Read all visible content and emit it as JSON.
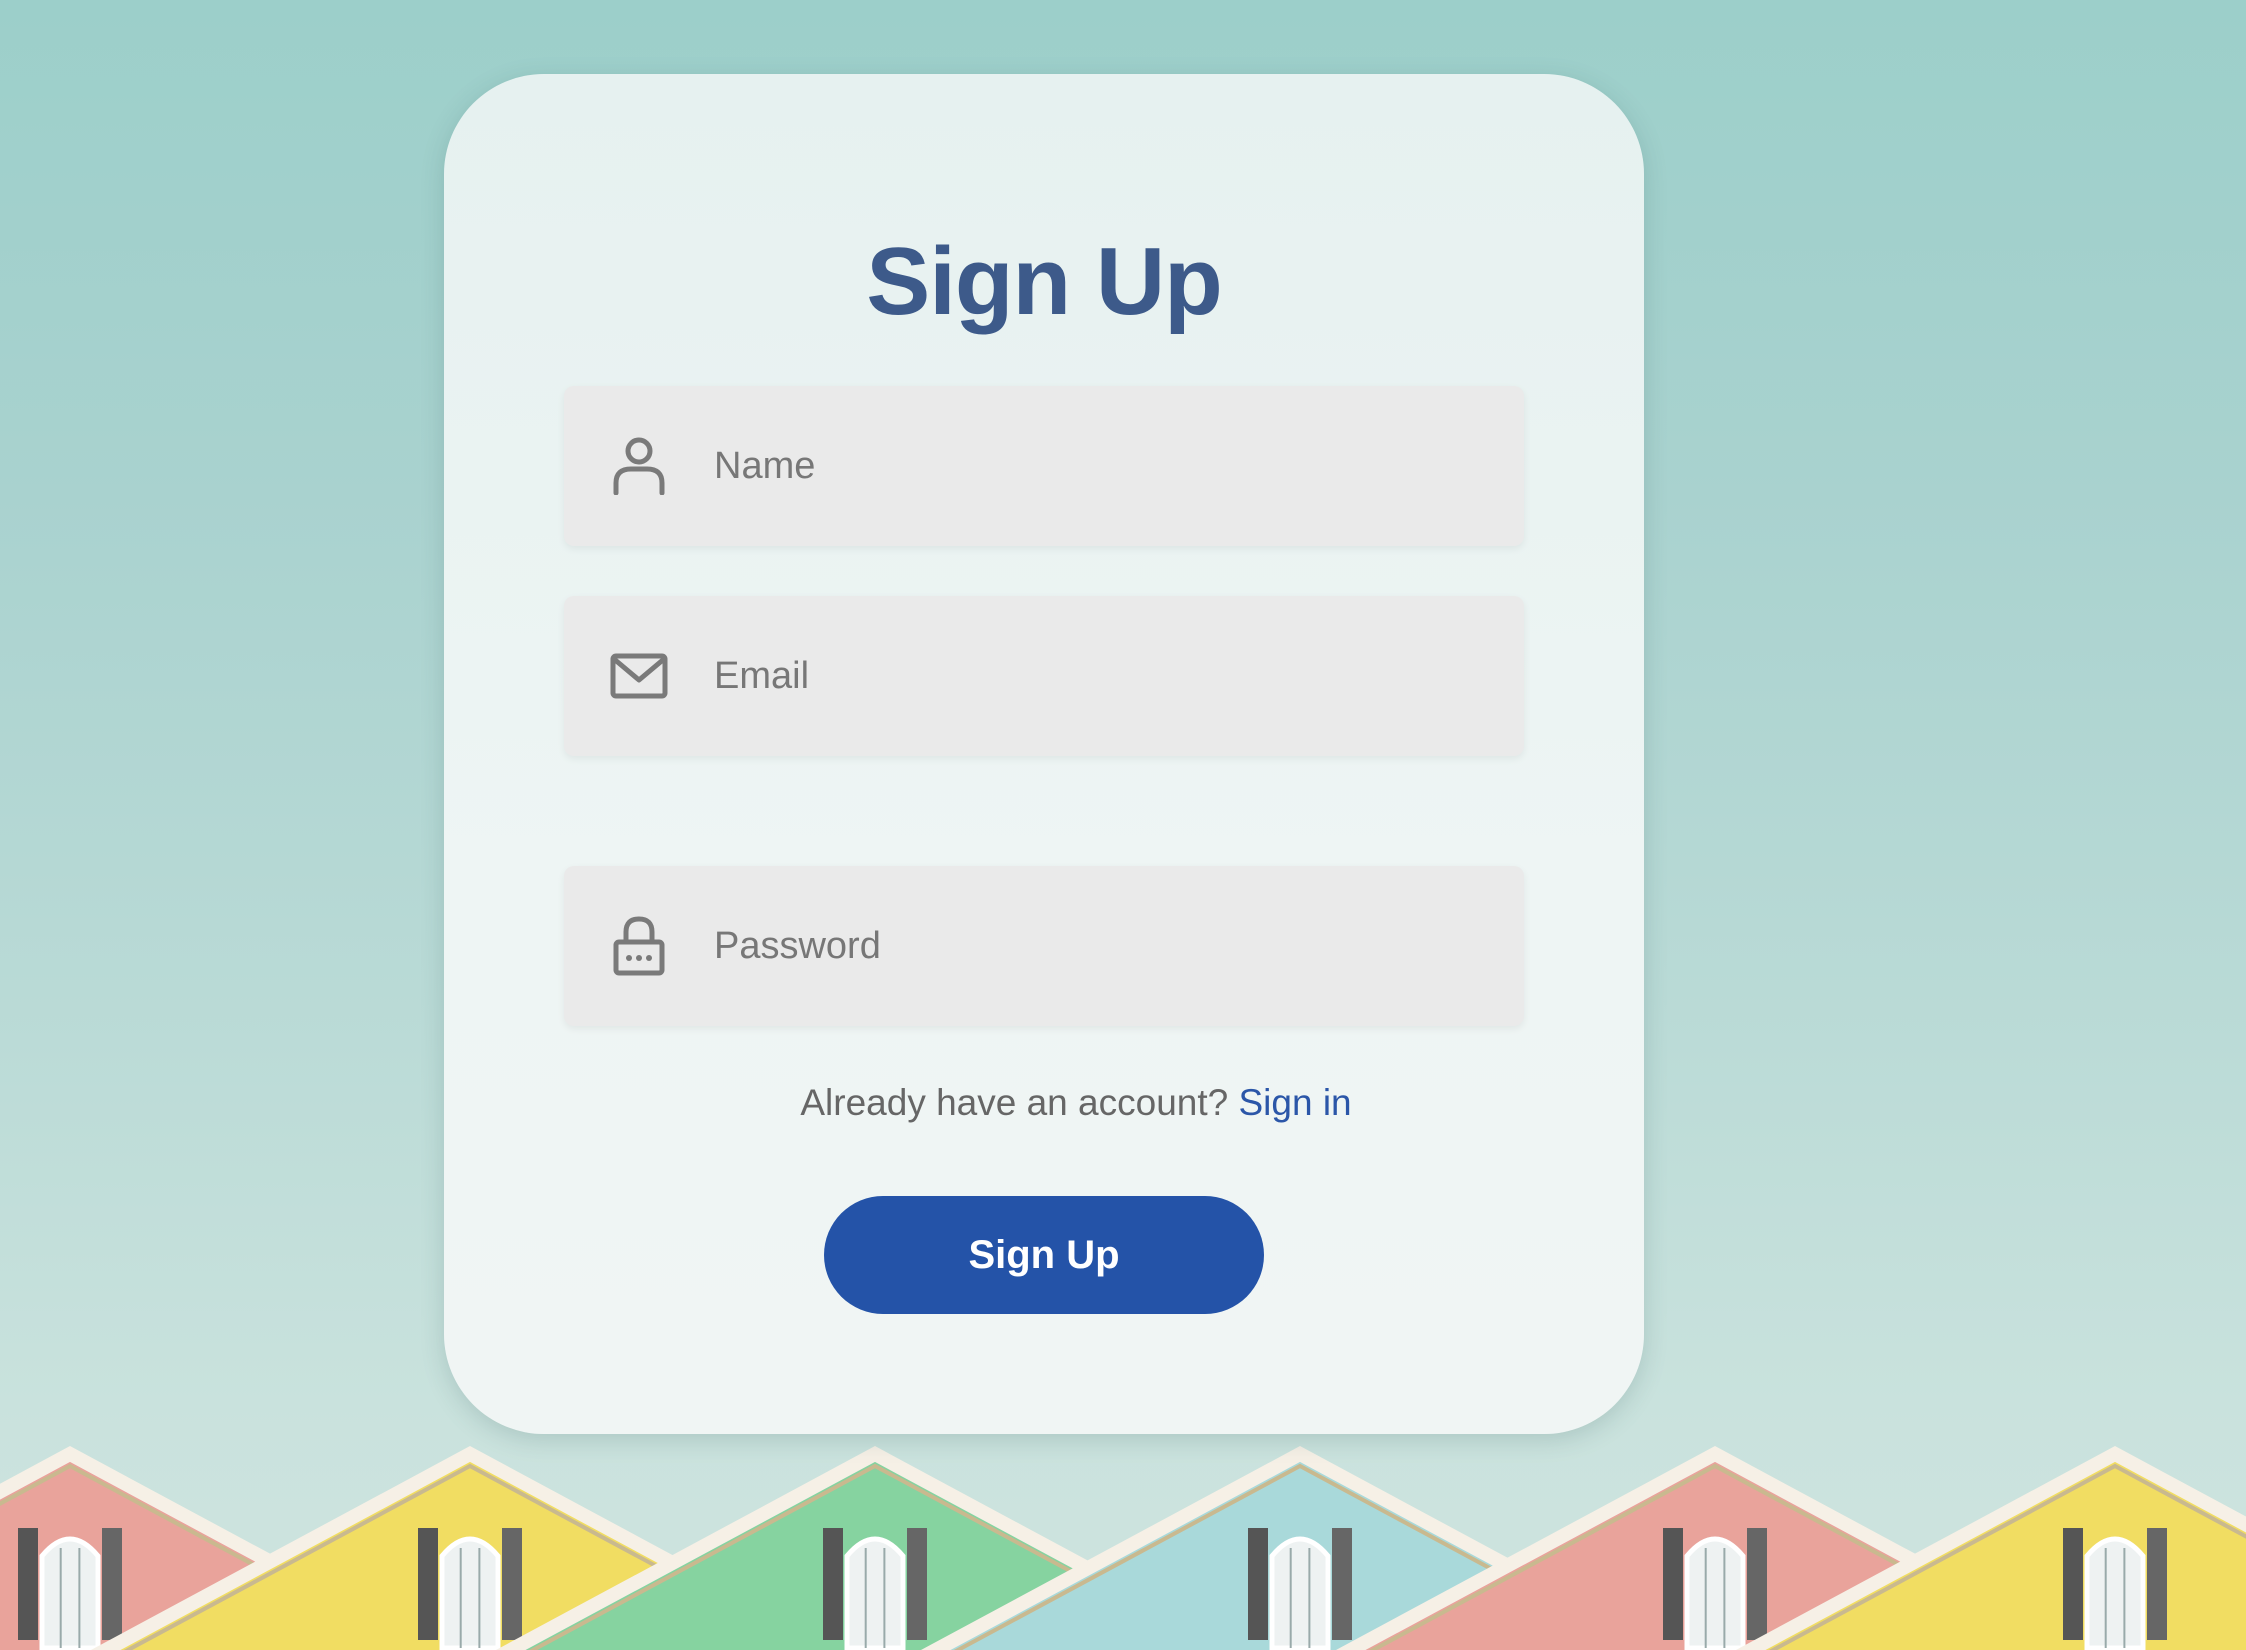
{
  "page": {
    "title": "Sign Up"
  },
  "form": {
    "name": {
      "placeholder": "Name",
      "icon": "user-icon"
    },
    "email": {
      "placeholder": "Email",
      "icon": "mail-icon"
    },
    "password": {
      "placeholder": "Password",
      "icon": "lock-icon"
    }
  },
  "signin": {
    "prompt": "Already have an account?",
    "link_label": "Sign in"
  },
  "submit_label": "Sign Up",
  "colors": {
    "title": "#3d5a8a",
    "button": "#2453a8",
    "link": "#2b56a8",
    "field_bg": "#eaeaea"
  },
  "background": {
    "description_icon": "rooftops-illustration",
    "house_colors": [
      "#e9a39b",
      "#f1dd62",
      "#86d3a0",
      "#a9d9da",
      "#e9a39b",
      "#f1dd62"
    ]
  }
}
